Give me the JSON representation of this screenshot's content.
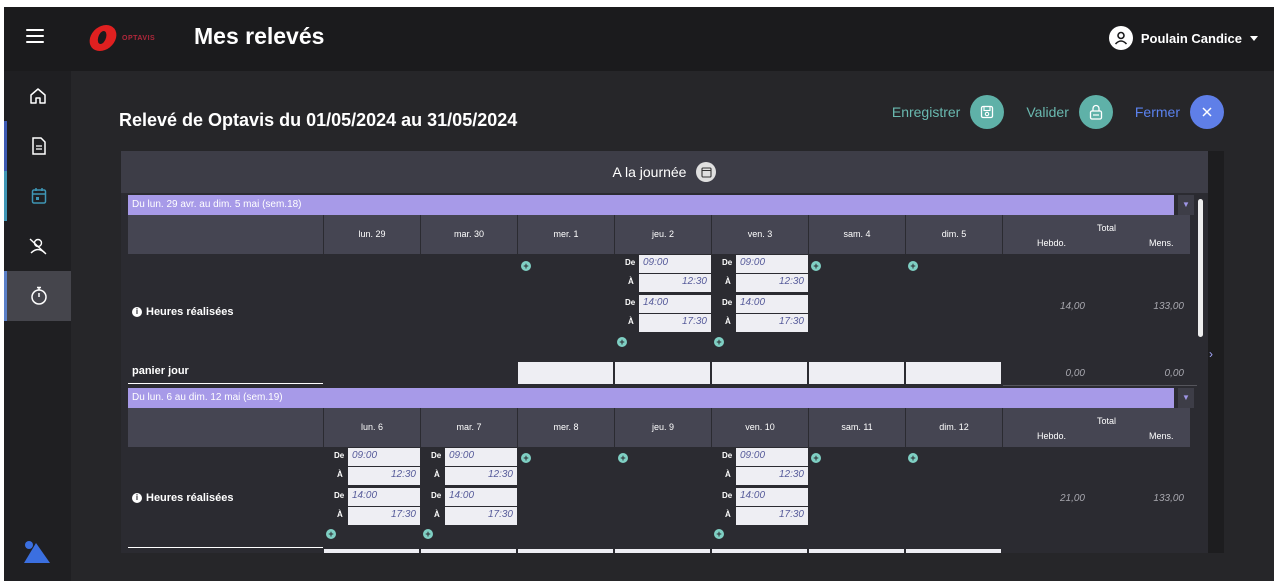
{
  "topbar": {
    "title": "Mes relevés",
    "logo_text": "OPTAVIS",
    "user_name": "Poulain Candice"
  },
  "sidebar": {
    "items": [
      {
        "icon": "home-icon"
      },
      {
        "icon": "document-icon"
      },
      {
        "icon": "calendar-icon"
      },
      {
        "icon": "user-off-icon"
      },
      {
        "icon": "stopwatch-icon"
      }
    ]
  },
  "page": {
    "title": "Relevé de Optavis du 01/05/2024 au 31/05/2024",
    "actions": {
      "save": "Enregistrer",
      "validate": "Valider",
      "close": "Fermer"
    }
  },
  "panel": {
    "mode_label": "A la journée",
    "weeks": [
      {
        "label": "Du lun. 29 avr. au dim. 5 mai (sem.18)",
        "days": [
          "lun. 29",
          "mar. 30",
          "mer. 1",
          "jeu. 2",
          "ven. 3",
          "sam. 4",
          "dim. 5"
        ],
        "total_label": "Total",
        "hebdo_label": "Hebdo.",
        "mens_label": "Mens.",
        "row_label": "Heures réalisées",
        "hebdo_value": "14,00",
        "mens_value": "133,00",
        "slots": [
          {
            "de": "De",
            "a": "À",
            "start": "09:00",
            "end": "12:30"
          },
          {
            "de": "De",
            "a": "À",
            "start": "14:00",
            "end": "17:30"
          },
          {
            "de": "De",
            "a": "À",
            "start": "09:00",
            "end": "12:30"
          },
          {
            "de": "De",
            "a": "À",
            "start": "14:00",
            "end": "17:30"
          }
        ],
        "panier_label": "panier jour",
        "panier_hebdo": "0,00",
        "panier_mens": "0,00"
      },
      {
        "label": "Du lun. 6 au dim. 12 mai (sem.19)",
        "days": [
          "lun. 6",
          "mar. 7",
          "mer. 8",
          "jeu. 9",
          "ven. 10",
          "sam. 11",
          "dim. 12"
        ],
        "total_label": "Total",
        "hebdo_label": "Hebdo.",
        "mens_label": "Mens.",
        "row_label": "Heures réalisées",
        "hebdo_value": "21,00",
        "mens_value": "133,00",
        "slots": [
          {
            "de": "De",
            "a": "À",
            "start": "09:00",
            "end": "12:30"
          },
          {
            "de": "De",
            "a": "À",
            "start": "14:00",
            "end": "17:30"
          },
          {
            "de": "De",
            "a": "À",
            "start": "09:00",
            "end": "12:30"
          },
          {
            "de": "De",
            "a": "À",
            "start": "14:00",
            "end": "17:30"
          },
          {
            "de": "De",
            "a": "À",
            "start": "09:00",
            "end": "12:30"
          },
          {
            "de": "De",
            "a": "À",
            "start": "14:00",
            "end": "17:30"
          }
        ]
      }
    ]
  },
  "colors": {
    "accent_teal": "#5fb1a8",
    "accent_blue": "#5f7fe8",
    "week_bar": "#a79ae8"
  }
}
